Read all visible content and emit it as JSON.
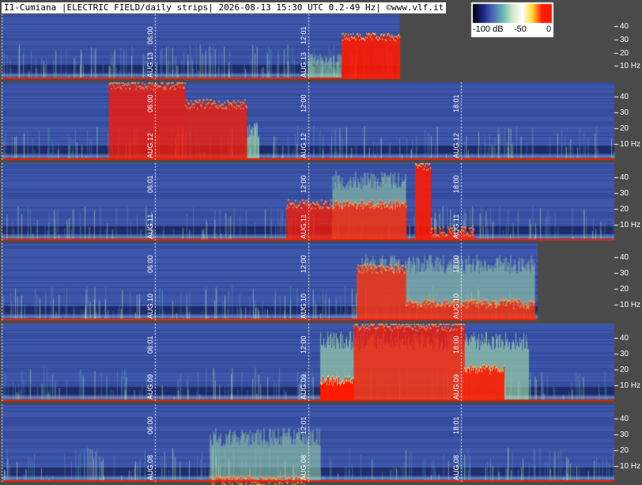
{
  "header": {
    "title": "I1-Cumiana |ELECTRIC FIELD/daily strips| 2026-08-13 15:30 UTC 0.2-49 Hz| ©www.vlf.it"
  },
  "colorbar": {
    "labels": [
      "-100 dB",
      "-50",
      "0"
    ],
    "stops": [
      "#000000",
      "#1a237e",
      "#4a66b8",
      "#64b4b4",
      "#d2e6c8",
      "#ffffff",
      "#ffdd33",
      "#ff1a00",
      "#ff1a00"
    ]
  },
  "colors": {
    "background": "#4a4a4a",
    "empty_area": "#4a4a4a",
    "spectrogram_base": "#3a52a6",
    "saturated": "#ff1a00",
    "grid_line": "#ffffff"
  },
  "chart_data": {
    "type": "heatmap",
    "frequency_range_hz": [
      0.2,
      49
    ],
    "y_tick_labels": [
      "40",
      "30",
      "20",
      "10 Hz"
    ],
    "y_tick_values": [
      40,
      30,
      20,
      10
    ],
    "color_scale_db": [
      -100,
      0
    ],
    "strips": [
      {
        "day": "AUG.13",
        "end_fraction": 0.65,
        "markers": [
          {
            "pos": 0.25,
            "date": "AUG.13",
            "time": "06:00"
          },
          {
            "pos": 0.5,
            "date": "AUG.13",
            "time": "12:01"
          }
        ],
        "saturated": [
          [
            0.555,
            0.65,
            0.32
          ]
        ],
        "bright": [
          [
            0.5,
            0.555,
            0.6
          ]
        ]
      },
      {
        "day": "AUG.12",
        "end_fraction": 1,
        "markers": [
          {
            "pos": 0.25,
            "date": "AUG.12",
            "time": "06:00"
          },
          {
            "pos": 0.5,
            "date": "AUG.12",
            "time": "12:00"
          },
          {
            "pos": 0.75,
            "date": "AUG.12",
            "time": "18:01"
          }
        ],
        "saturated": [
          [
            0.175,
            0.3,
            0.0
          ],
          [
            0.3,
            0.4,
            0.25
          ]
        ],
        "bright": [
          [
            0.4,
            0.42,
            0.5
          ]
        ]
      },
      {
        "day": "AUG.11",
        "end_fraction": 1,
        "markers": [
          {
            "pos": 0.25,
            "date": "AUG.11",
            "time": "06:01"
          },
          {
            "pos": 0.5,
            "date": "AUG.11",
            "time": "12:00"
          },
          {
            "pos": 0.75,
            "date": "AUG.11",
            "time": "18:00"
          }
        ],
        "saturated": [
          [
            0.465,
            0.66,
            0.5
          ],
          [
            0.675,
            0.7,
            0.0
          ],
          [
            0.7,
            0.77,
            0.85
          ]
        ],
        "bright": [
          [
            0.54,
            0.66,
            0.1
          ]
        ]
      },
      {
        "day": "AUG.10",
        "end_fraction": 0.875,
        "markers": [
          {
            "pos": 0.25,
            "date": "AUG.10",
            "time": "06:00"
          },
          {
            "pos": 0.5,
            "date": "AUG.10",
            "time": "12:00"
          },
          {
            "pos": 0.75,
            "date": "AUG.10",
            "time": "18:00"
          }
        ],
        "saturated": [
          [
            0.58,
            0.66,
            0.3
          ],
          [
            0.66,
            0.87,
            0.75
          ]
        ],
        "bright": [
          [
            0.58,
            0.87,
            0.15
          ]
        ]
      },
      {
        "day": "AUG.09",
        "end_fraction": 1,
        "markers": [
          {
            "pos": 0.25,
            "date": "AUG.09",
            "time": "06:01"
          },
          {
            "pos": 0.5,
            "date": "AUG.09",
            "time": "12:00"
          },
          {
            "pos": 0.75,
            "date": "AUG.09",
            "time": "18:00"
          }
        ],
        "saturated": [
          [
            0.52,
            0.575,
            0.7
          ],
          [
            0.575,
            0.755,
            0.0
          ],
          [
            0.755,
            0.82,
            0.55
          ]
        ],
        "bright": [
          [
            0.52,
            0.86,
            0.1
          ]
        ]
      },
      {
        "day": "AUG.08",
        "end_fraction": 1,
        "markers": [
          {
            "pos": 0.25,
            "date": "AUG.08",
            "time": "06:00"
          },
          {
            "pos": 0.5,
            "date": "AUG.08",
            "time": "12:01"
          },
          {
            "pos": 0.75,
            "date": "AUG.08",
            "time": "18:01"
          }
        ],
        "saturated": [
          [
            0.34,
            0.5,
            0.95
          ]
        ],
        "bright": [
          [
            0.34,
            0.52,
            0.3
          ]
        ]
      }
    ]
  }
}
